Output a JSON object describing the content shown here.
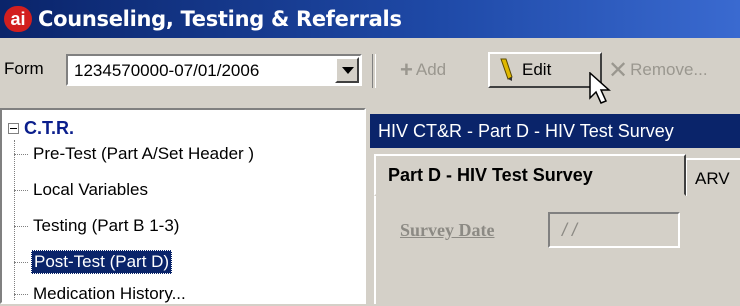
{
  "window": {
    "app_icon": "ai",
    "title": "Counseling, Testing & Referrals"
  },
  "form_select": {
    "label": "Form",
    "value": "1234570000-07/01/2006"
  },
  "toolbar": {
    "add_label": "Add",
    "edit_label": "Edit",
    "remove_label": "Remove..."
  },
  "tree": {
    "root": "C.T.R.",
    "items": [
      {
        "label": "Pre-Test (Part A/Set Header )",
        "selected": false
      },
      {
        "label": "Local Variables",
        "selected": false
      },
      {
        "label": "Testing (Part B 1-3)",
        "selected": false
      },
      {
        "label": "Post-Test (Part D)",
        "selected": true
      },
      {
        "label": "Medication History...",
        "selected": false
      }
    ]
  },
  "panel": {
    "header": "HIV CT&R - Part D - HIV Test Survey",
    "tabs": [
      "Part D - HIV Test Survey",
      "ARV"
    ],
    "survey_date_label": "Survey Date",
    "survey_date_value": "/ /"
  },
  "colors": {
    "title_bar": "#0a246a",
    "selection": "#0a246a",
    "logo": "#d21f1f"
  }
}
